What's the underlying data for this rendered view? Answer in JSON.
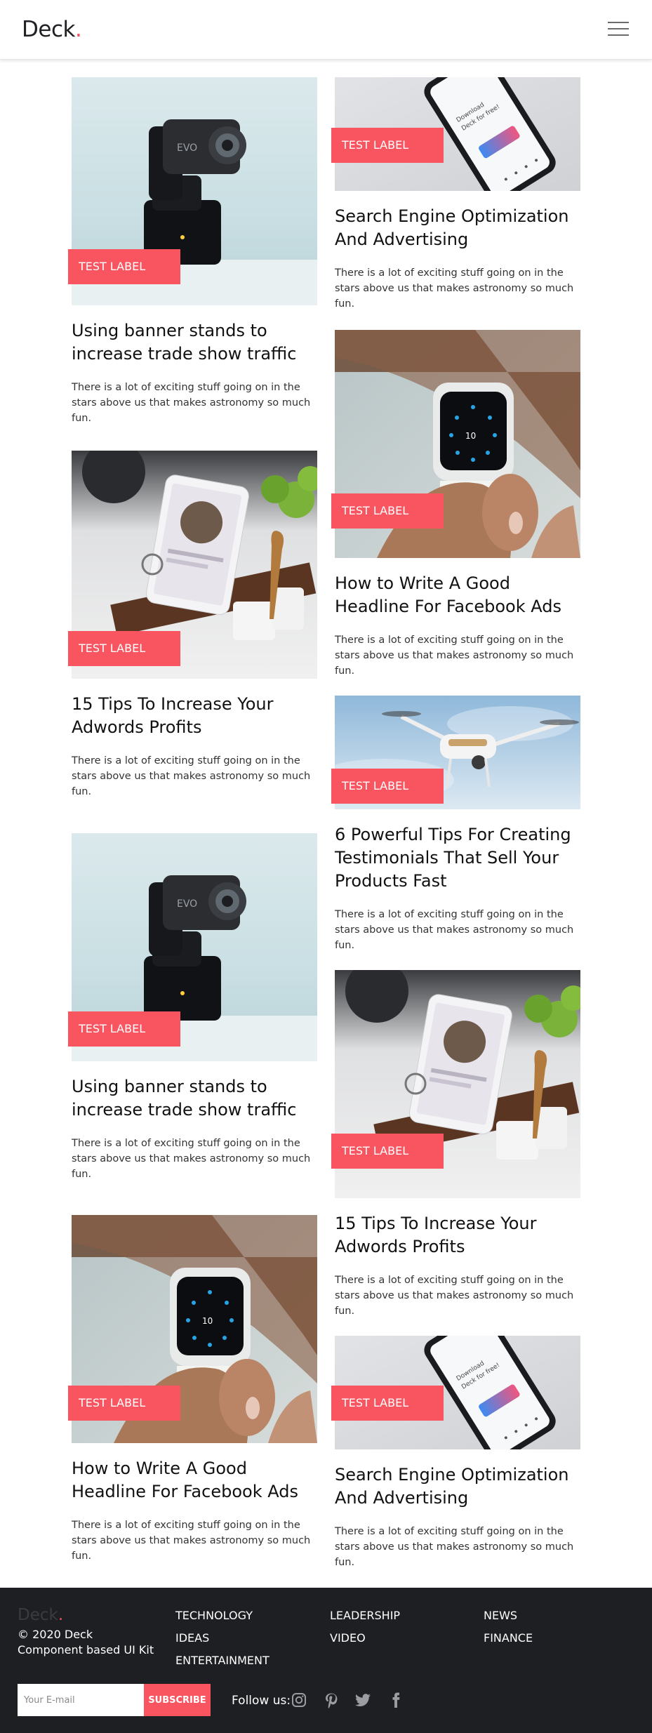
{
  "header": {
    "brand": "Deck",
    "brand_dot": ".",
    "menu_icon": "hamburger-menu-icon"
  },
  "posts": {
    "left": [
      {
        "label": "TEST LABEL",
        "title_l1": "Using banner stands to",
        "title_l2": "increase trade show traffic",
        "title_l3": "",
        "text_l1": "There is a lot of exciting stuff going on in the",
        "text_l2": "stars above us that makes astronomy so much",
        "text_l3": "fun.",
        "image": "gimbal-camera"
      },
      {
        "label": "TEST LABEL",
        "title_l1": "15 Tips To Increase Your",
        "title_l2": "Adwords Profits",
        "title_l3": "",
        "text_l1": "There is a lot of exciting stuff going on in the",
        "text_l2": "stars above us that makes astronomy so much",
        "text_l3": "fun.",
        "image": "tablet-on-counter"
      },
      {
        "label": "TEST LABEL",
        "title_l1": "Using banner stands to",
        "title_l2": "increase trade show traffic",
        "title_l3": "",
        "text_l1": "There is a lot of exciting stuff going on in the",
        "text_l2": "stars above us that makes astronomy so much",
        "text_l3": "fun.",
        "image": "gimbal-camera"
      },
      {
        "label": "TEST LABEL",
        "title_l1": "How to Write A Good",
        "title_l2": "Headline For Facebook Ads",
        "title_l3": "",
        "text_l1": "There is a lot of exciting stuff going on in the",
        "text_l2": "stars above us that makes astronomy so much",
        "text_l3": "fun.",
        "image": "smartwatch-wrist"
      }
    ],
    "right": [
      {
        "label": "TEST LABEL",
        "title_l1": "Search Engine Optimization",
        "title_l2": "And Advertising",
        "title_l3": "",
        "text_l1": "There is a lot of exciting stuff going on in the",
        "text_l2": "stars above us that makes astronomy so much",
        "text_l3": "fun.",
        "image": "smartphone"
      },
      {
        "label": "TEST LABEL",
        "title_l1": "How to Write A Good",
        "title_l2": "Headline For Facebook Ads",
        "title_l3": "",
        "text_l1": "There is a lot of exciting stuff going on in the",
        "text_l2": "stars above us that makes astronomy so much",
        "text_l3": "fun.",
        "image": "smartwatch-wrist"
      },
      {
        "label": "TEST LABEL",
        "title_l1": "6 Powerful Tips For Creating",
        "title_l2": "Testimonials That Sell Your",
        "title_l3": "Products Fast",
        "text_l1": "There is a lot of exciting stuff going on in the",
        "text_l2": "stars above us that makes astronomy so much",
        "text_l3": "fun.",
        "image": "drone"
      },
      {
        "label": "TEST LABEL",
        "title_l1": "15 Tips To Increase Your",
        "title_l2": "Adwords Profits",
        "title_l3": "",
        "text_l1": "There is a lot of exciting stuff going on in the",
        "text_l2": "stars above us that makes astronomy so much",
        "text_l3": "fun.",
        "image": "tablet-on-counter"
      },
      {
        "label": "TEST LABEL",
        "title_l1": "Search Engine Optimization",
        "title_l2": "And Advertising",
        "title_l3": "",
        "text_l1": "There is a lot of exciting stuff going on in the",
        "text_l2": "stars above us that makes astronomy so much",
        "text_l3": "fun.",
        "image": "smartphone"
      }
    ]
  },
  "footer": {
    "brand": "Deck",
    "brand_dot": ".",
    "copyright": "© 2020 Deck",
    "tagline": "Component based UI Kit",
    "links": {
      "technology": "TECHNOLOGY",
      "ideas": "IDEAS",
      "entertainment": "ENTERTAINMENT",
      "leadership": "LEADERSHIP",
      "video": "VIDEO",
      "news": "NEWS",
      "finance": "FINANCE"
    },
    "email_placeholder": "Your E-mail",
    "subscribe_label": "SUBSCRIBE",
    "follow_label": "Follow us:",
    "social_icons": [
      "instagram-icon",
      "pinterest-icon",
      "twitter-icon",
      "facebook-icon"
    ]
  },
  "colors": {
    "accent": "#f85561",
    "footer_bg": "#1e1f23",
    "brand_dot": "#f04e56"
  }
}
